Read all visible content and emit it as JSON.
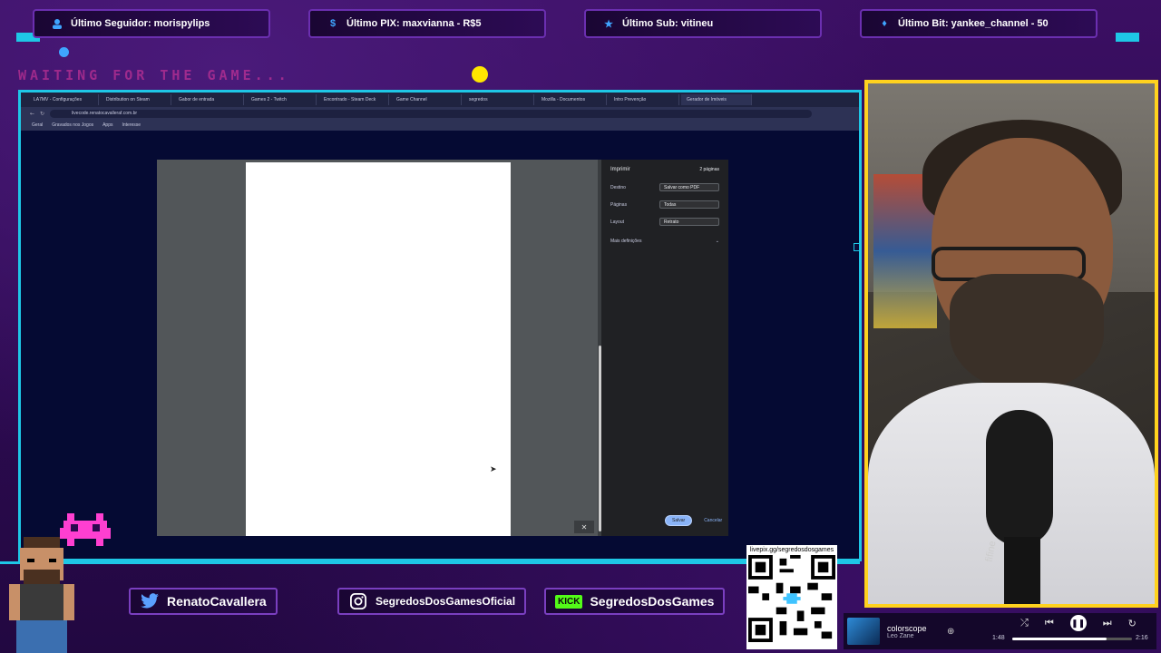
{
  "ticker": {
    "follower": "Último Seguidor: morispylips",
    "pix": "Último PIX: maxvianna - R$5",
    "sub": "Último Sub: vitineu",
    "bit": "Último Bit: yankee_channel - 50"
  },
  "waiting_text": "WAITING FOR THE GAME...",
  "browser": {
    "tabs": [
      "LA7MV - Configurações",
      "Distribution on Steam",
      "Gabor de entrada",
      "Games 2 - Twitch",
      "Encontrado - Steam Deck",
      "Game Channel",
      "segredos",
      "Mozilla - Documentos",
      "Intro Prevenção",
      "Gerador de Imóveis"
    ],
    "url": "livecode.renatocavalleraf.com.br",
    "bookmarks": [
      "Geral",
      "Gravados nos Jogos",
      "Apps",
      "Interesse"
    ]
  },
  "print_dialog": {
    "title": "Imprimir",
    "pages_info": "2 páginas",
    "destination_label": "Destino",
    "destination_value": "Salvar como PDF",
    "pages_label": "Páginas",
    "pages_value": "Todas",
    "layout_label": "Layout",
    "layout_value": "Retrato",
    "more_settings": "Mais definições",
    "save_button": "Salvar",
    "cancel_button": "Cancelar"
  },
  "webcam": {
    "mic_brand": "fifine"
  },
  "social": {
    "twitter": "RenatoCavallera",
    "instagram": "SegredosDosGamesOficial",
    "kick_badge": "KICK",
    "kick": "SegredosDosGames"
  },
  "qr": {
    "label": "livepix.gg/segredosdosgames"
  },
  "player": {
    "track": "colorscope",
    "artist": "Leo Zane",
    "elapsed": "1:48",
    "total": "2:16",
    "progress": 0.79
  },
  "colors": {
    "accent_cyan": "#1ec7e6",
    "accent_yellow": "#ffd21e",
    "accent_pink": "#e63aa0",
    "kick_green": "#53fc18"
  }
}
